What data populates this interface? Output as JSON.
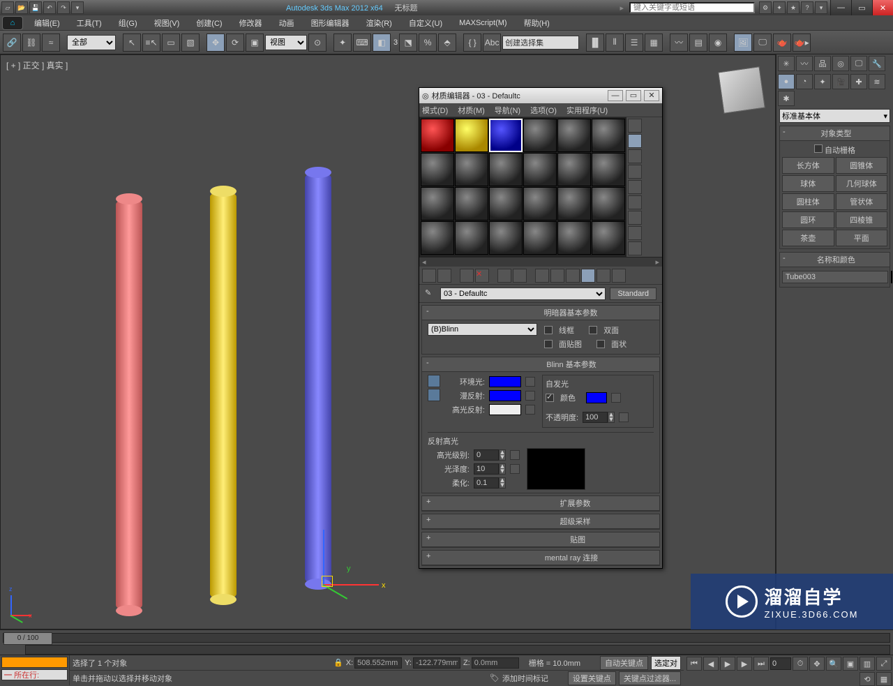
{
  "title": {
    "app": "Autodesk 3ds Max  2012 x64",
    "doc": "无标题"
  },
  "search": {
    "placeholder": "键入关键字或短语"
  },
  "menu": [
    "编辑(E)",
    "工具(T)",
    "组(G)",
    "视图(V)",
    "创建(C)",
    "修改器",
    "动画",
    "图形编辑器",
    "渲染(R)",
    "自定义(U)",
    "MAXScript(M)",
    "帮助(H)"
  ],
  "toolbar": {
    "filter": "全部",
    "viewsel": "视图",
    "namedsel": "创建选择集"
  },
  "viewport": {
    "label": "[ + ] 正交 ] 真实 ]",
    "axes": {
      "x": "x",
      "y": "y",
      "z": "z"
    }
  },
  "rightpanel": {
    "dropdown": "标准基本体",
    "objtype_header": "对象类型",
    "autogrid": "自动栅格",
    "buttons": [
      "长方体",
      "圆锥体",
      "球体",
      "几何球体",
      "圆柱体",
      "管状体",
      "圆环",
      "四棱锥",
      "茶壶",
      "平面"
    ],
    "namecolor_header": "名称和颜色",
    "objname": "Tube003"
  },
  "matedit": {
    "title": "材质编辑器 - 03 - Defaultc",
    "menu": [
      "模式(D)",
      "材质(M)",
      "导航(N)",
      "选项(O)",
      "实用程序(U)"
    ],
    "matname": "03 - Defaultc",
    "standard": "Standard",
    "rollouts": {
      "shader": "明暗器基本参数",
      "shader_type": "(B)Blinn",
      "wire": "线框",
      "twoSided": "双面",
      "faceMap": "面贴图",
      "faceted": "面状",
      "blinn": "Blinn 基本参数",
      "ambient": "环境光:",
      "diffuse": "漫反射:",
      "specular": "高光反射:",
      "selfillum_group": "自发光",
      "selfillum": "颜色",
      "opacity": "不透明度:",
      "opacity_val": "100",
      "spechl": "反射高光",
      "speclevel": "高光级别:",
      "speclevel_val": "0",
      "gloss": "光泽度:",
      "gloss_val": "10",
      "soften": "柔化:",
      "soften_val": "0.1",
      "ext": "扩展参数",
      "ss": "超级采样",
      "maps": "贴图",
      "mr": "mental ray 连接"
    }
  },
  "timeline": {
    "pos": "0 / 100"
  },
  "status": {
    "sel": "选择了 1 个对象",
    "hint": "单击并拖动以选择并移动对象",
    "x_lbl": "X:",
    "x": "508.552mm",
    "y_lbl": "Y:",
    "y": "-122.779mm",
    "z_lbl": "Z:",
    "z": "0.0mm",
    "grid": "栅格 = 10.0mm",
    "autokey": "自动关键点",
    "selkey": "选定对",
    "setkey": "设置关键点",
    "keyfilter": "关键点过滤器...",
    "addtime": "添加时间标记",
    "nowlbl": "所在行:"
  },
  "watermark": {
    "big": "溜溜自学",
    "small": "ZIXUE.3D66.COM"
  },
  "angle": "3"
}
